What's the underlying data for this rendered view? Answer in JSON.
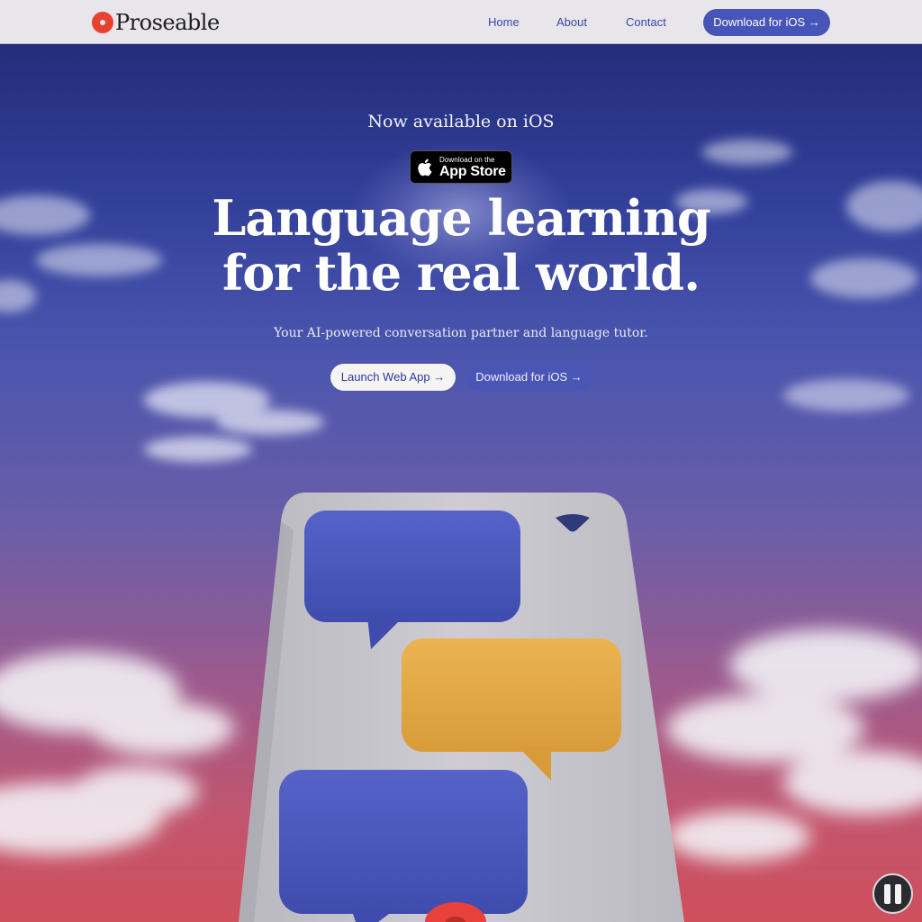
{
  "nav": {
    "brand": "Proseable",
    "links": [
      "Home",
      "About",
      "Contact"
    ],
    "cta_label": "Download for iOS →"
  },
  "hero": {
    "eyebrow": "Now available on iOS",
    "appstore": {
      "small": "Download on the",
      "big": "App Store"
    },
    "headline_line1": "Language learning",
    "headline_line2": "for the real world.",
    "subhead": "Your AI-powered conversation partner and language tutor.",
    "cta_web": "Launch Web App →",
    "cta_ios": "Download for iOS →"
  },
  "colors": {
    "brand_red": "#e8412f",
    "accent_blue": "#4754b8",
    "bubble_blue": "#4b58bf",
    "bubble_yellow": "#e3a845"
  },
  "icons": [
    "apple-icon",
    "pause-icon",
    "logo-icon"
  ]
}
